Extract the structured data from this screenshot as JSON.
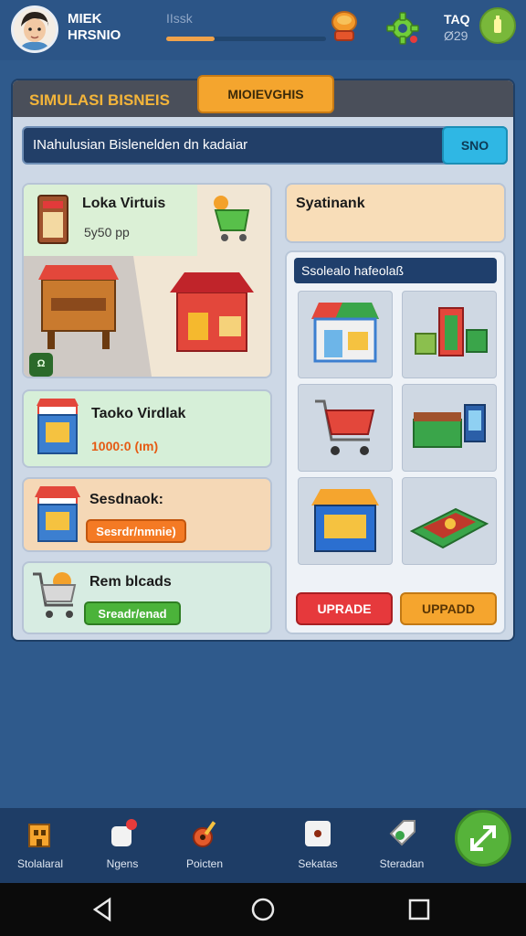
{
  "hud": {
    "player_name_line1": "MIEK",
    "player_name_line2": "HRSNIO",
    "label": "IIssk",
    "progress": 0.3,
    "stat_line1": "TAQ",
    "stat_line2": "Ø29"
  },
  "tabs": {
    "simulasi": "SIMULASI BISNEIS",
    "active": "MIOIEVGHIS"
  },
  "search": {
    "text": "INahulusian Bislenelden dn kadaiar",
    "button": "SNO"
  },
  "cards": {
    "lokal": {
      "title": "Loka Virtuis",
      "sub": "5y50 pp",
      "badge": "Ω"
    },
    "toko": {
      "title": "Taoko Virdlak",
      "value": "1000:0 (ım)"
    },
    "sesd": {
      "title": "Sesdnaok:",
      "button": "Sesrdr/nmnie)"
    },
    "rem": {
      "title": "Rem blcads",
      "button": "Sreadr/enad"
    },
    "syst": {
      "title": "Syatinank"
    }
  },
  "shop": {
    "title": "Ssolealo hafeolaß",
    "btn_red": "UPRADE",
    "btn_orange": "UPPADD"
  },
  "nav": [
    {
      "label": "Stolalaral"
    },
    {
      "label": "Ngens"
    },
    {
      "label": "Poicten"
    },
    {
      "label": "Sekatas"
    },
    {
      "label": "Steradan"
    }
  ],
  "colors": {
    "background": "#2f5a8c",
    "accent_orange": "#f4a52e",
    "accent_red": "#e6393c",
    "accent_green": "#56b33a",
    "accent_cyan": "#2fb7e4"
  }
}
